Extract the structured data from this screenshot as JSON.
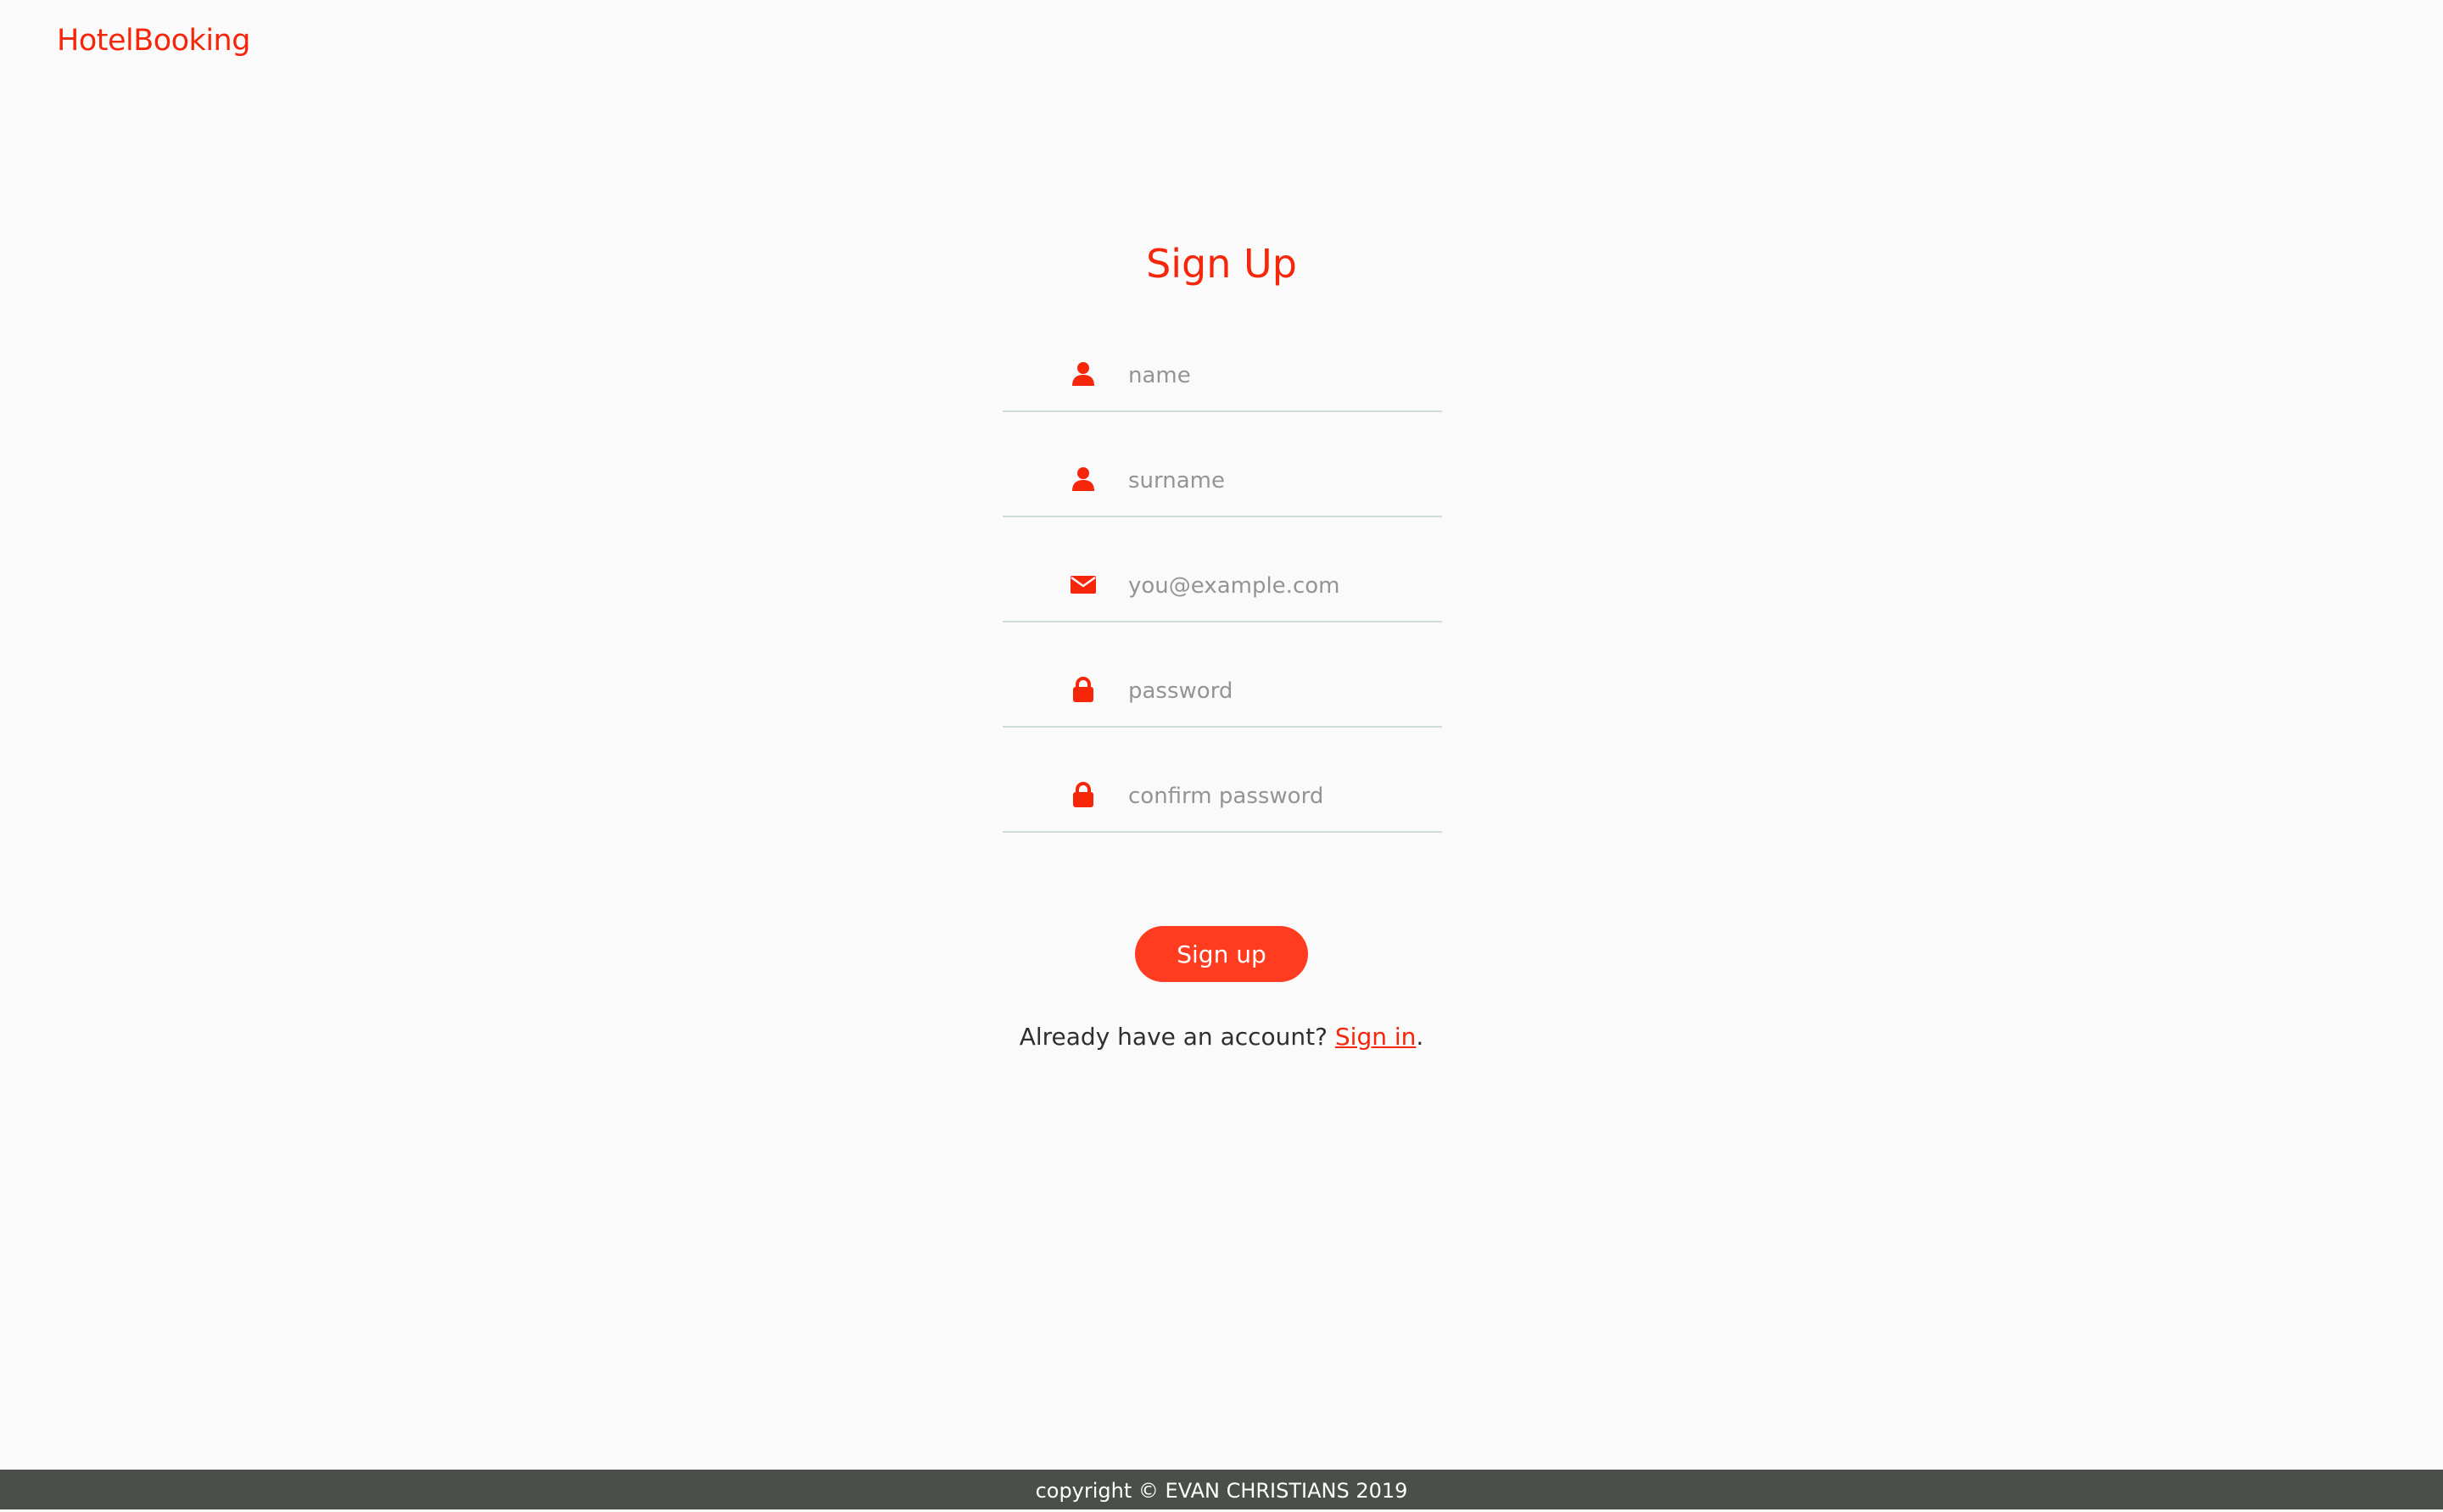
{
  "brand": {
    "name": "HotelBooking",
    "color": "#f5260a"
  },
  "page": {
    "title": "Sign Up"
  },
  "form": {
    "fields": [
      {
        "name": "name",
        "placeholder": "name",
        "value": "",
        "icon": "user-icon"
      },
      {
        "name": "surname",
        "placeholder": "surname",
        "value": "",
        "icon": "user-icon"
      },
      {
        "name": "email",
        "placeholder": "you@example.com",
        "value": "",
        "icon": "envelope-icon"
      },
      {
        "name": "password",
        "placeholder": "password",
        "value": "",
        "icon": "lock-icon"
      },
      {
        "name": "confirm_password",
        "placeholder": "confirm password",
        "value": "",
        "icon": "lock-icon"
      }
    ],
    "submit_label": "Sign up",
    "submit_color": "#ff3b20"
  },
  "signin_prompt": {
    "text": "Already have an account? ",
    "link_label": "Sign in",
    "suffix": "."
  },
  "footer": {
    "text": "copyright © EVAN CHRISTIANS 2019",
    "background": "#4a4f4a"
  }
}
